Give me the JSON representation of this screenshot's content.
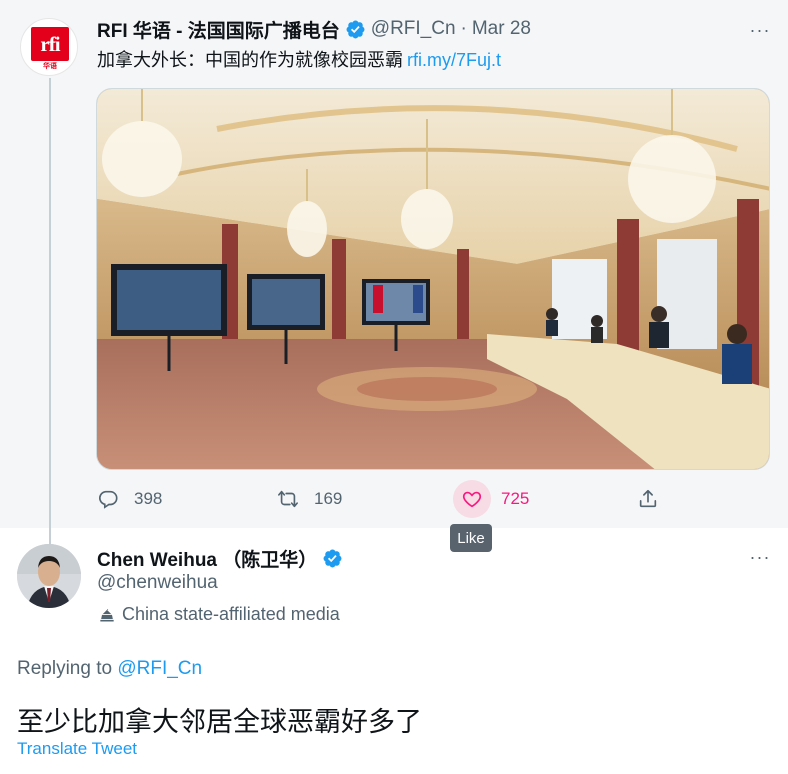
{
  "parent_tweet": {
    "avatar_text": "rfi",
    "avatar_subtext": "华语",
    "display_name": "RFI 华语 - 法国国际广播电台",
    "handle": "@RFI_Cn",
    "separator": "·",
    "date": "Mar 28",
    "text": "加拿大外长：中国的作为就像校园恶霸",
    "link": "rfi.my/7Fuj.t",
    "media": {
      "description_icon": "photo-icon"
    },
    "actions": {
      "replies": "398",
      "retweets": "169",
      "likes": "725"
    },
    "tooltip": "Like"
  },
  "reply_tweet": {
    "display_name": "Chen Weihua （陈卫华）",
    "handle": "@chenweihua",
    "affiliation": "China state-affiliated media",
    "replying_label": "Replying to",
    "replying_to": "@RFI_Cn",
    "text": "至少比加拿大邻居全球恶霸好多了",
    "translate": "Translate Tweet"
  },
  "more_label": "···",
  "colors": {
    "accent": "#1d9bf0",
    "like": "#f91880",
    "muted": "#536471",
    "rfi_red": "#e2001a"
  }
}
